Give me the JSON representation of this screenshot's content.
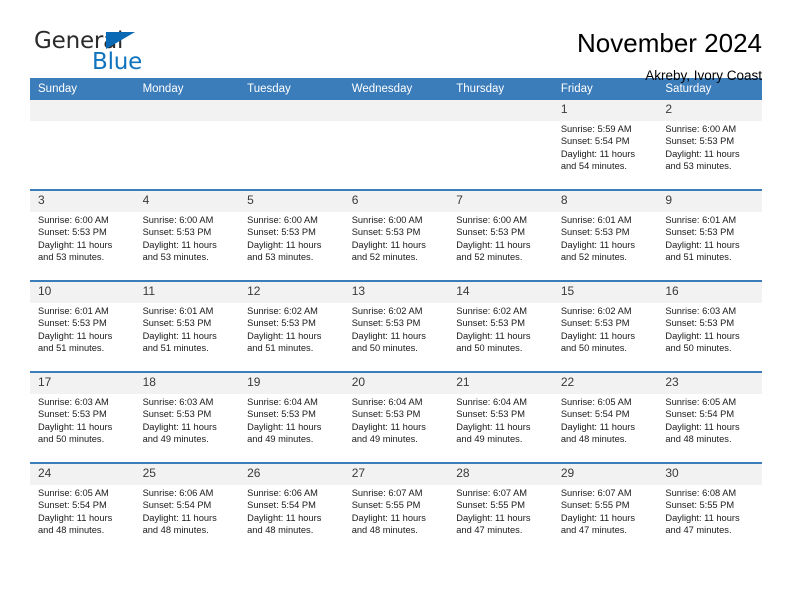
{
  "brand": {
    "name_top": "General",
    "name_bottom": "Blue",
    "triangle_color": "#0a69b5",
    "blue_text_color": "#0f73bd"
  },
  "header": {
    "title": "November 2024",
    "subtitle": "Akreby, Ivory Coast"
  },
  "theme": {
    "header_blue": "#3b7cba",
    "daynum_band": "#f2f2f2",
    "text": "#000000"
  },
  "weekdays": [
    "Sunday",
    "Monday",
    "Tuesday",
    "Wednesday",
    "Thursday",
    "Friday",
    "Saturday"
  ],
  "weeks": [
    [
      {
        "day": "",
        "sunrise": "",
        "sunset": "",
        "daylight_line1": "",
        "daylight_line2": ""
      },
      {
        "day": "",
        "sunrise": "",
        "sunset": "",
        "daylight_line1": "",
        "daylight_line2": ""
      },
      {
        "day": "",
        "sunrise": "",
        "sunset": "",
        "daylight_line1": "",
        "daylight_line2": ""
      },
      {
        "day": "",
        "sunrise": "",
        "sunset": "",
        "daylight_line1": "",
        "daylight_line2": ""
      },
      {
        "day": "",
        "sunrise": "",
        "sunset": "",
        "daylight_line1": "",
        "daylight_line2": ""
      },
      {
        "day": "1",
        "sunrise": "Sunrise: 5:59 AM",
        "sunset": "Sunset: 5:54 PM",
        "daylight_line1": "Daylight: 11 hours",
        "daylight_line2": "and 54 minutes."
      },
      {
        "day": "2",
        "sunrise": "Sunrise: 6:00 AM",
        "sunset": "Sunset: 5:53 PM",
        "daylight_line1": "Daylight: 11 hours",
        "daylight_line2": "and 53 minutes."
      }
    ],
    [
      {
        "day": "3",
        "sunrise": "Sunrise: 6:00 AM",
        "sunset": "Sunset: 5:53 PM",
        "daylight_line1": "Daylight: 11 hours",
        "daylight_line2": "and 53 minutes."
      },
      {
        "day": "4",
        "sunrise": "Sunrise: 6:00 AM",
        "sunset": "Sunset: 5:53 PM",
        "daylight_line1": "Daylight: 11 hours",
        "daylight_line2": "and 53 minutes."
      },
      {
        "day": "5",
        "sunrise": "Sunrise: 6:00 AM",
        "sunset": "Sunset: 5:53 PM",
        "daylight_line1": "Daylight: 11 hours",
        "daylight_line2": "and 53 minutes."
      },
      {
        "day": "6",
        "sunrise": "Sunrise: 6:00 AM",
        "sunset": "Sunset: 5:53 PM",
        "daylight_line1": "Daylight: 11 hours",
        "daylight_line2": "and 52 minutes."
      },
      {
        "day": "7",
        "sunrise": "Sunrise: 6:00 AM",
        "sunset": "Sunset: 5:53 PM",
        "daylight_line1": "Daylight: 11 hours",
        "daylight_line2": "and 52 minutes."
      },
      {
        "day": "8",
        "sunrise": "Sunrise: 6:01 AM",
        "sunset": "Sunset: 5:53 PM",
        "daylight_line1": "Daylight: 11 hours",
        "daylight_line2": "and 52 minutes."
      },
      {
        "day": "9",
        "sunrise": "Sunrise: 6:01 AM",
        "sunset": "Sunset: 5:53 PM",
        "daylight_line1": "Daylight: 11 hours",
        "daylight_line2": "and 51 minutes."
      }
    ],
    [
      {
        "day": "10",
        "sunrise": "Sunrise: 6:01 AM",
        "sunset": "Sunset: 5:53 PM",
        "daylight_line1": "Daylight: 11 hours",
        "daylight_line2": "and 51 minutes."
      },
      {
        "day": "11",
        "sunrise": "Sunrise: 6:01 AM",
        "sunset": "Sunset: 5:53 PM",
        "daylight_line1": "Daylight: 11 hours",
        "daylight_line2": "and 51 minutes."
      },
      {
        "day": "12",
        "sunrise": "Sunrise: 6:02 AM",
        "sunset": "Sunset: 5:53 PM",
        "daylight_line1": "Daylight: 11 hours",
        "daylight_line2": "and 51 minutes."
      },
      {
        "day": "13",
        "sunrise": "Sunrise: 6:02 AM",
        "sunset": "Sunset: 5:53 PM",
        "daylight_line1": "Daylight: 11 hours",
        "daylight_line2": "and 50 minutes."
      },
      {
        "day": "14",
        "sunrise": "Sunrise: 6:02 AM",
        "sunset": "Sunset: 5:53 PM",
        "daylight_line1": "Daylight: 11 hours",
        "daylight_line2": "and 50 minutes."
      },
      {
        "day": "15",
        "sunrise": "Sunrise: 6:02 AM",
        "sunset": "Sunset: 5:53 PM",
        "daylight_line1": "Daylight: 11 hours",
        "daylight_line2": "and 50 minutes."
      },
      {
        "day": "16",
        "sunrise": "Sunrise: 6:03 AM",
        "sunset": "Sunset: 5:53 PM",
        "daylight_line1": "Daylight: 11 hours",
        "daylight_line2": "and 50 minutes."
      }
    ],
    [
      {
        "day": "17",
        "sunrise": "Sunrise: 6:03 AM",
        "sunset": "Sunset: 5:53 PM",
        "daylight_line1": "Daylight: 11 hours",
        "daylight_line2": "and 50 minutes."
      },
      {
        "day": "18",
        "sunrise": "Sunrise: 6:03 AM",
        "sunset": "Sunset: 5:53 PM",
        "daylight_line1": "Daylight: 11 hours",
        "daylight_line2": "and 49 minutes."
      },
      {
        "day": "19",
        "sunrise": "Sunrise: 6:04 AM",
        "sunset": "Sunset: 5:53 PM",
        "daylight_line1": "Daylight: 11 hours",
        "daylight_line2": "and 49 minutes."
      },
      {
        "day": "20",
        "sunrise": "Sunrise: 6:04 AM",
        "sunset": "Sunset: 5:53 PM",
        "daylight_line1": "Daylight: 11 hours",
        "daylight_line2": "and 49 minutes."
      },
      {
        "day": "21",
        "sunrise": "Sunrise: 6:04 AM",
        "sunset": "Sunset: 5:53 PM",
        "daylight_line1": "Daylight: 11 hours",
        "daylight_line2": "and 49 minutes."
      },
      {
        "day": "22",
        "sunrise": "Sunrise: 6:05 AM",
        "sunset": "Sunset: 5:54 PM",
        "daylight_line1": "Daylight: 11 hours",
        "daylight_line2": "and 48 minutes."
      },
      {
        "day": "23",
        "sunrise": "Sunrise: 6:05 AM",
        "sunset": "Sunset: 5:54 PM",
        "daylight_line1": "Daylight: 11 hours",
        "daylight_line2": "and 48 minutes."
      }
    ],
    [
      {
        "day": "24",
        "sunrise": "Sunrise: 6:05 AM",
        "sunset": "Sunset: 5:54 PM",
        "daylight_line1": "Daylight: 11 hours",
        "daylight_line2": "and 48 minutes."
      },
      {
        "day": "25",
        "sunrise": "Sunrise: 6:06 AM",
        "sunset": "Sunset: 5:54 PM",
        "daylight_line1": "Daylight: 11 hours",
        "daylight_line2": "and 48 minutes."
      },
      {
        "day": "26",
        "sunrise": "Sunrise: 6:06 AM",
        "sunset": "Sunset: 5:54 PM",
        "daylight_line1": "Daylight: 11 hours",
        "daylight_line2": "and 48 minutes."
      },
      {
        "day": "27",
        "sunrise": "Sunrise: 6:07 AM",
        "sunset": "Sunset: 5:55 PM",
        "daylight_line1": "Daylight: 11 hours",
        "daylight_line2": "and 48 minutes."
      },
      {
        "day": "28",
        "sunrise": "Sunrise: 6:07 AM",
        "sunset": "Sunset: 5:55 PM",
        "daylight_line1": "Daylight: 11 hours",
        "daylight_line2": "and 47 minutes."
      },
      {
        "day": "29",
        "sunrise": "Sunrise: 6:07 AM",
        "sunset": "Sunset: 5:55 PM",
        "daylight_line1": "Daylight: 11 hours",
        "daylight_line2": "and 47 minutes."
      },
      {
        "day": "30",
        "sunrise": "Sunrise: 6:08 AM",
        "sunset": "Sunset: 5:55 PM",
        "daylight_line1": "Daylight: 11 hours",
        "daylight_line2": "and 47 minutes."
      }
    ]
  ]
}
